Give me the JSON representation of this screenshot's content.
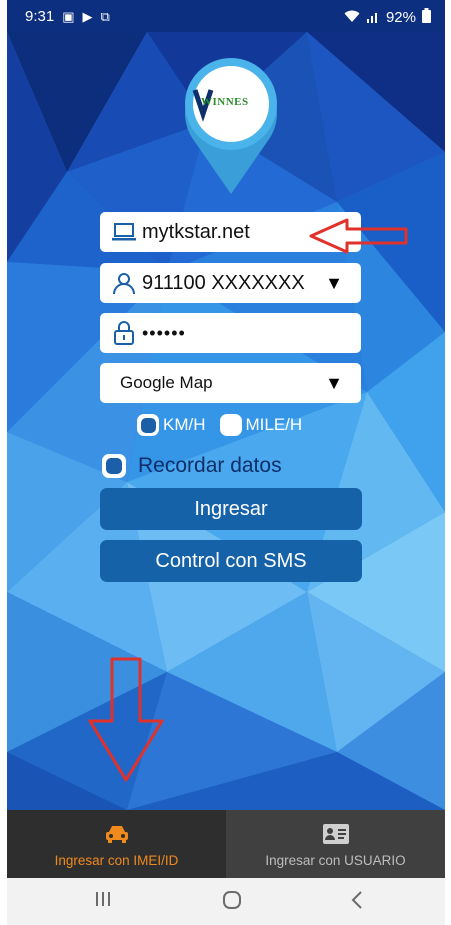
{
  "status_bar": {
    "time": "9:31",
    "battery": "92%"
  },
  "logo": {
    "text": "WINNES"
  },
  "form": {
    "server": "mytkstar.net",
    "account": "911100 XXXXXXX",
    "password": "••••••",
    "map_type": "Google Map",
    "unit_kmh": "KM/H",
    "unit_mileh": "MILE/H",
    "remember_label": "Recordar datos"
  },
  "buttons": {
    "login": "Ingresar",
    "sms": "Control con SMS"
  },
  "tabs": [
    {
      "label": "Ingresar con IMEI/ID",
      "icon": "car-icon",
      "active": true
    },
    {
      "label": "Ingresar con USUARIO",
      "icon": "id-card-icon",
      "active": false
    }
  ],
  "colors": {
    "accent_tab": "#f08a1d",
    "button": "#1562a8",
    "status_bar": "#0c2f80"
  }
}
